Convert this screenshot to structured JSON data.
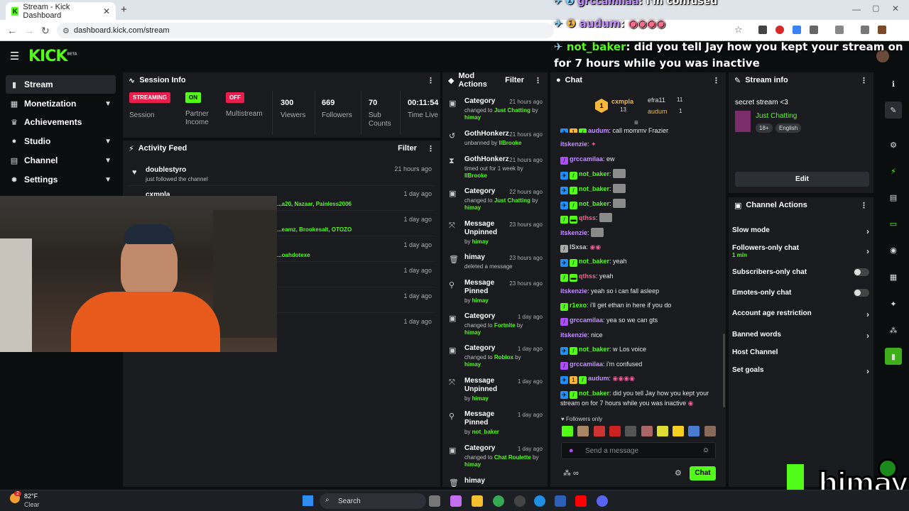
{
  "browser": {
    "tab_title": "Stream - Kick Dashboard",
    "url": "dashboard.kick.com/stream"
  },
  "app": {
    "logo": "KICK",
    "logo_tag": "BETA"
  },
  "sidebar": {
    "items": [
      {
        "label": "Stream",
        "icon": "signal-icon"
      },
      {
        "label": "Monetization",
        "icon": "dollar-icon"
      },
      {
        "label": "Achievements",
        "icon": "trophy-icon"
      },
      {
        "label": "Studio",
        "icon": "studio-icon"
      },
      {
        "label": "Channel",
        "icon": "channel-icon"
      },
      {
        "label": "Settings",
        "icon": "gear-icon"
      }
    ]
  },
  "session": {
    "title": "Session Info",
    "streaming_badge": "STREAMING",
    "streaming_label": "Session",
    "partner_badge": "ON",
    "partner_label": "Partner Income",
    "multistream_badge": "OFF",
    "multistream_label": "Multistream",
    "viewers": "300",
    "viewers_label": "Viewers",
    "followers": "669",
    "followers_label": "Followers",
    "subs": "70",
    "subs_label": "Sub Counts",
    "time": "00:11:54",
    "time_label": "Time Live"
  },
  "activity": {
    "title": "Activity Feed",
    "filter": "Filter",
    "items": [
      {
        "name": "doublestyro",
        "sub": "just followed the channel",
        "time": "21 hours ago"
      },
      {
        "name": "cxmpla",
        "sub": "...a20, Nazaar, Painless2006",
        "time": "1 day ago"
      },
      {
        "name": "",
        "sub": "...eamz, Brookesalt, OTOZO",
        "time": "1 day ago"
      },
      {
        "name": "",
        "sub": "...oahdotexe",
        "time": "1 day ago"
      },
      {
        "name": "",
        "sub": "",
        "time": "1 day ago"
      },
      {
        "name": "",
        "sub": "",
        "time": "1 day ago"
      },
      {
        "name": "",
        "sub": "",
        "time": "1 day ago"
      }
    ]
  },
  "mod_actions": {
    "title": "Mod Actions",
    "filter": "Filter",
    "items": [
      {
        "icon": "category-icon",
        "title": "Category",
        "time": "21 hours ago",
        "sub_pre": "changed to ",
        "sub_hl": "Just Chatting",
        "sub_by": "himay"
      },
      {
        "icon": "unban-icon",
        "title": "GothHonkerz",
        "time": "21 hours ago",
        "sub_pre": "unbanned by ",
        "sub_hl": "IlBrooke",
        "sub_by": ""
      },
      {
        "icon": "hourglass-icon",
        "title": "GothHonkerz",
        "time": "21 hours ago",
        "sub_pre": "timed out for 1 week by ",
        "sub_hl": "IlBrooke",
        "sub_by": ""
      },
      {
        "icon": "category-icon",
        "title": "Category",
        "time": "22 hours ago",
        "sub_pre": "changed to ",
        "sub_hl": "Just Chatting",
        "sub_by": "himay"
      },
      {
        "icon": "unpin-icon",
        "title": "Message Unpinned",
        "time": "23 hours ago",
        "sub_pre": "by ",
        "sub_hl": "himay",
        "sub_by": ""
      },
      {
        "icon": "trash-icon",
        "title": "himay",
        "time": "23 hours ago",
        "sub_pre": "deleted a message",
        "sub_hl": "",
        "sub_by": ""
      },
      {
        "icon": "pin-icon",
        "title": "Message Pinned",
        "time": "23 hours ago",
        "sub_pre": "by ",
        "sub_hl": "himay",
        "sub_by": ""
      },
      {
        "icon": "category-icon",
        "title": "Category",
        "time": "1 day ago",
        "sub_pre": "changed to ",
        "sub_hl": "Fortnite",
        "sub_by": "himay"
      },
      {
        "icon": "category-icon",
        "title": "Category",
        "time": "1 day ago",
        "sub_pre": "changed to ",
        "sub_hl": "Roblox",
        "sub_by": "himay"
      },
      {
        "icon": "unpin-icon",
        "title": "Message Unpinned",
        "time": "1 day ago",
        "sub_pre": "by ",
        "sub_hl": "himay",
        "sub_by": ""
      },
      {
        "icon": "pin-icon",
        "title": "Message Pinned",
        "time": "1 day ago",
        "sub_pre": "by ",
        "sub_hl": "not_baker",
        "sub_by": ""
      },
      {
        "icon": "category-icon",
        "title": "Category",
        "time": "1 day ago",
        "sub_pre": "changed to ",
        "sub_hl": "Chat Roulette",
        "sub_by": "himay"
      },
      {
        "icon": "trash-icon",
        "title": "himay",
        "time": "",
        "sub_pre": "",
        "sub_hl": "",
        "sub_by": ""
      }
    ]
  },
  "chat": {
    "title": "Chat",
    "top_gifters": [
      {
        "name": "cxmpla",
        "count": "13"
      },
      {
        "name": "efra11",
        "count": "11"
      },
      {
        "name": "audum",
        "count": "1"
      }
    ],
    "messages": [
      {
        "user": "audum",
        "color": "#c38dff",
        "text": "call mommy Frazier"
      },
      {
        "user": "itskenzie",
        "color": "#c38dff",
        "text": ""
      },
      {
        "user": "grccamilaa",
        "color": "#c38dff",
        "text": "ew"
      },
      {
        "user": "not_baker",
        "color": "#53fc18",
        "text": ""
      },
      {
        "user": "not_baker",
        "color": "#53fc18",
        "text": ""
      },
      {
        "user": "not_baker",
        "color": "#53fc18",
        "text": ""
      },
      {
        "user": "qthss",
        "color": "#ff5b8a",
        "text": ""
      },
      {
        "user": "itskenzie",
        "color": "#c38dff",
        "text": ""
      },
      {
        "user": "lSxsa",
        "color": "#cccccc",
        "text": ""
      },
      {
        "user": "not_baker",
        "color": "#53fc18",
        "text": "yeah"
      },
      {
        "user": "qthss",
        "color": "#ff5b8a",
        "text": "yeah"
      },
      {
        "user": "itskenzie",
        "color": "#c38dff",
        "text": "yeah so i can fall asleep"
      },
      {
        "user": "r1exo",
        "color": "#53fc18",
        "text": "i'll get ethan in here if you do"
      },
      {
        "user": "grccamilaa",
        "color": "#c38dff",
        "text": "yea so we can gts"
      },
      {
        "user": "itskenzie",
        "color": "#c38dff",
        "text": "nice"
      },
      {
        "user": "not_baker",
        "color": "#53fc18",
        "text": "w Los voice"
      },
      {
        "user": "grccamilaa",
        "color": "#c38dff",
        "text": "i'm confused"
      },
      {
        "user": "audum",
        "color": "#c38dff",
        "text": ""
      },
      {
        "user": "not_baker",
        "color": "#53fc18",
        "text": "did you tell Jay how you kept your stream on for 7 hours while you was inactive"
      }
    ],
    "followers_only": "Followers only",
    "input_placeholder": "Send a message",
    "send_label": "Chat"
  },
  "stream_info": {
    "title": "Stream info",
    "stream_title": "secret stream <3",
    "category": "Just Chatting",
    "tags": [
      "18+",
      "English"
    ],
    "edit_label": "Edit"
  },
  "channel_actions": {
    "title": "Channel Actions",
    "slow_mode": "Slow mode",
    "followers_only": "Followers-only chat",
    "followers_only_sub": "1 min",
    "subs_only": "Subscribers-only chat",
    "emotes_only": "Emotes-only chat",
    "age": "Account age restriction",
    "banned": "Banned words",
    "host": "Host Channel",
    "goals": "Set goals"
  },
  "overlay": {
    "line1_user": "grccamilaa",
    "line1_text": "i'm confused",
    "line2_user": "audum",
    "line3_user": "not_baker",
    "line3_text": "did you tell Jay how you kept your stream on",
    "line3_text2": "for 7 hours while you was inactive",
    "watermark": "himay"
  },
  "taskbar": {
    "weather_temp": "82°F",
    "weather_desc": "Clear",
    "search": "Search",
    "weather_badge": "2"
  },
  "colors": {
    "accent": "#53fc18",
    "panel": "#191b1f",
    "bg": "#0b0e0f",
    "live_red": "#e91e4c"
  }
}
